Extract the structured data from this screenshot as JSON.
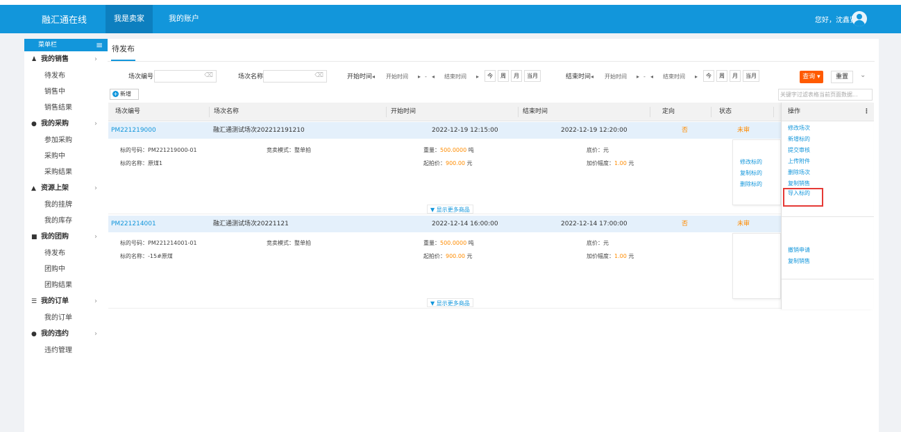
{
  "header": {
    "brand": "融汇通在线",
    "nav": [
      {
        "label": "我是卖家",
        "active": true
      },
      {
        "label": "我的账户",
        "active": false
      }
    ],
    "greeting": "您好，沈鑫贤"
  },
  "sidebar": {
    "title": "菜单栏",
    "groups": [
      {
        "label": "我的销售",
        "icon": "sales-icon",
        "items": [
          "待发布",
          "销售中",
          "销售结果"
        ]
      },
      {
        "label": "我的采购",
        "icon": "check-circle-icon",
        "items": [
          "参加采购",
          "采购中",
          "采购结果"
        ]
      },
      {
        "label": "资源上架",
        "icon": "graduation-cap-icon",
        "items": [
          "我的挂牌",
          "我的库存"
        ]
      },
      {
        "label": "我的团购",
        "icon": "group-icon",
        "items": [
          "待发布",
          "团购中",
          "团购结果"
        ]
      },
      {
        "label": "我的订单",
        "icon": "list-icon",
        "items": [
          "我的订单"
        ]
      },
      {
        "label": "我的违约",
        "icon": "alert-icon",
        "items": [
          "违约管理"
        ]
      }
    ]
  },
  "tab": {
    "label": "待发布"
  },
  "filters": {
    "session_code_label": "场次编号",
    "session_name_label": "场次名称",
    "start_time_label": "开始时间",
    "end_time_label": "结束时间",
    "range_start_placeholder": "开始时间",
    "range_end_placeholder": "结束时间",
    "range_dash": "-",
    "quick": [
      "今",
      "周",
      "月",
      "当月"
    ],
    "query_label": "查询",
    "reset_label": "重置"
  },
  "toolbar": {
    "add_label": "新增",
    "search_placeholder": "关键字过滤表格当前页面数据..."
  },
  "table": {
    "columns": [
      "场次编号",
      "场次名称",
      "开始时间",
      "结束时间",
      "定向",
      "状态"
    ],
    "ops_column": "操作",
    "rows": [
      {
        "code": "PM221219000",
        "name": "融汇通测试场次202212191210",
        "start": "2022-12-19 12:15:00",
        "end": "2022-12-19 12:20:00",
        "directed": "否",
        "status": "未审",
        "lot": {
          "lot_no_label": "标的号码：",
          "lot_no": "PM221219000-01",
          "lot_name_label": "标的名称：",
          "lot_name": "原煤1",
          "mode_label": "竞卖模式：",
          "mode": "整单拍",
          "weight_label": "重量：",
          "weight": "500.0000",
          "weight_unit": "吨",
          "start_price_label": "起拍价：",
          "start_price": "900.00",
          "price_unit": "元",
          "base_price_label": "底价：",
          "base_price": "元",
          "increment_label": "加价幅度：",
          "increment": "1.00",
          "increment_unit": "元"
        },
        "lot_ops": [
          "修改标的",
          "复制标的",
          "删除标的"
        ],
        "ops": [
          "修改场次",
          "新增标的",
          "提交审核",
          "上传附件",
          "删除场次",
          "复制销售",
          "导入标的"
        ]
      },
      {
        "code": "PM221214001",
        "name": "融汇通测试场次20221121",
        "start": "2022-12-14 16:00:00",
        "end": "2022-12-14 17:00:00",
        "directed": "否",
        "status": "未审",
        "lot": {
          "lot_no_label": "标的号码：",
          "lot_no": "PM221214001-01",
          "lot_name_label": "标的名称：",
          "lot_name": "-15#原煤",
          "mode_label": "竞卖模式：",
          "mode": "整单拍",
          "weight_label": "重量：",
          "weight": "500.0000",
          "weight_unit": "吨",
          "start_price_label": "起拍价：",
          "start_price": "900.00",
          "price_unit": "元",
          "base_price_label": "底价：",
          "base_price": "元",
          "increment_label": "加价幅度：",
          "increment": "1.00",
          "increment_unit": "元"
        },
        "lot_ops": [],
        "ops": [
          "撤销申请",
          "复制销售"
        ]
      }
    ],
    "show_more": "▼ 显示更多商品"
  },
  "colors": {
    "primary": "#1296db",
    "accent": "#ff5a00",
    "highlight": "#e53935",
    "status": "#ff8c00"
  }
}
